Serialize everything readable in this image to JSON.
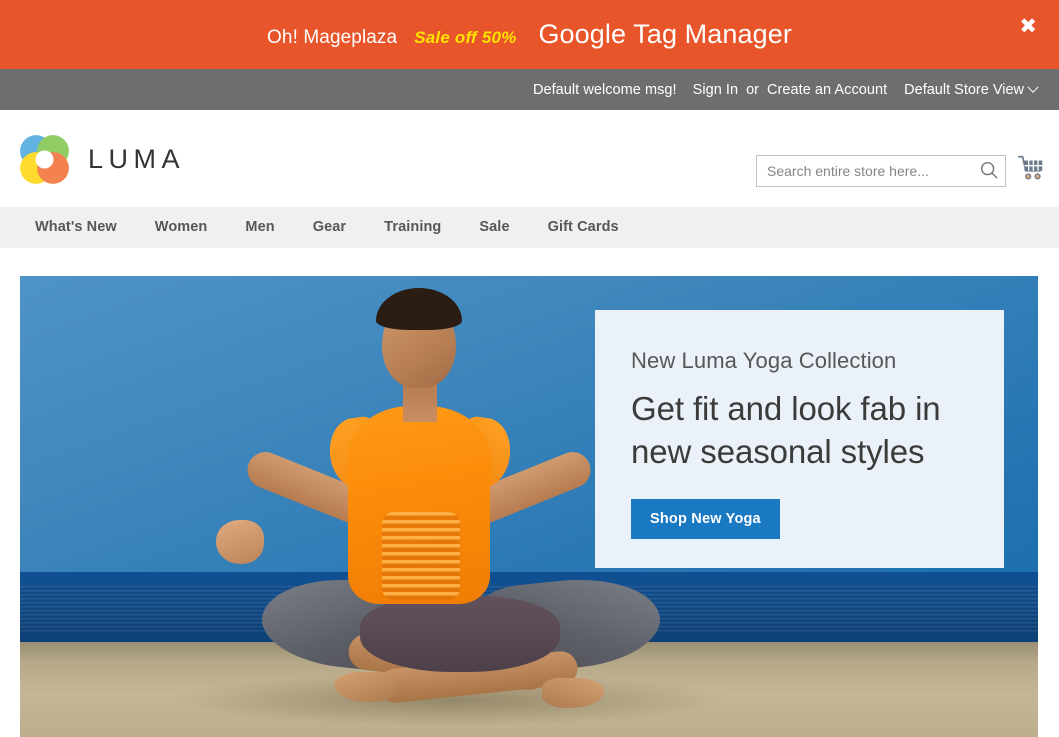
{
  "promo_banner": {
    "brand": "Oh! Mageplaza",
    "sale": "Sale off 50%",
    "title": "Google Tag Manager",
    "close_label": "✖",
    "bg_color": "#e8552a",
    "sale_color": "#ffe300"
  },
  "panel": {
    "welcome": "Default welcome msg!",
    "sign_in": "Sign In",
    "separator": "or",
    "create_account": "Create an Account",
    "store_view": "Default Store View",
    "bg_color": "#6e6e6e"
  },
  "header": {
    "logo_text": "LUMA",
    "logo_icon": "luma-flower-logo",
    "search": {
      "placeholder": "Search entire store here...",
      "value": "",
      "icon": "search-icon"
    },
    "cart": {
      "icon": "shopping-cart-icon",
      "count": ""
    }
  },
  "navigation": {
    "items": [
      {
        "label": "What's New"
      },
      {
        "label": "Women"
      },
      {
        "label": "Men"
      },
      {
        "label": "Gear"
      },
      {
        "label": "Training"
      },
      {
        "label": "Sale"
      },
      {
        "label": "Gift Cards"
      }
    ]
  },
  "hero": {
    "image_description": "Woman in orange top meditating in lotus pose on a beach with blue sky and ocean",
    "eyebrow": "New Luma Yoga Collection",
    "headline": "Get fit and look fab in new seasonal styles",
    "cta_label": "Shop New Yoga",
    "cta_color": "#1979c3",
    "card_bg": "#eaf1f8"
  }
}
